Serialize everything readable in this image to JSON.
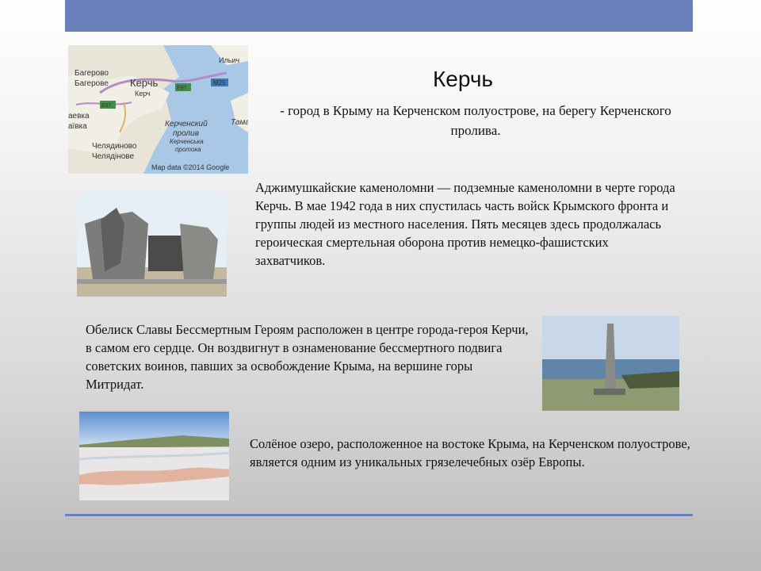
{
  "title": "Керчь",
  "subtitle": "- город в Крыму на Керченском полуострове, на берегу Керченского пролива.",
  "map": {
    "labels": {
      "bagerovo_ru": "Багерово",
      "bagerovo_ua": "Багерове",
      "kerch_ru": "Керчь",
      "kerch_ua": "Керч",
      "ilyich": "Ильич",
      "road_e97_a": "E97",
      "road_e97_b": "E97",
      "road_m25": "M25",
      "aevka": "аевка",
      "aivka": "аївка",
      "strait_ru": "Керченский",
      "strait_ru2": "пролив",
      "strait_ua": "Керченська",
      "strait_ua2": "протока",
      "taman": "Тама",
      "chelyadinovo_ru": "Челядиново",
      "chelyadinovo_ua": "Челядінове",
      "credit": "Map data ©2014 Google"
    }
  },
  "sections": [
    {
      "text": "Аджимушкайские каменоломни — подземные каменоломни в черте города Керчь. В мае 1942 года в них спустилась часть войск Крымского фронта и группы людей из местного населения. Пять месяцев здесь продолжалась героическая смертельная оборона против немецко-фашистских захватчиков."
    },
    {
      "text": "Обелиск Славы Бессмертным Героям расположен в центре города-героя Керчи, в самом его сердце. Он воздвигнут в ознаменование бессмертного подвига советских воинов, павших за освобождение Крыма, на вершине горы Митридат."
    },
    {
      "text": "Солёное озеро, расположенное на востоке Крыма, на Керченском полуострове, является одним из уникальных грязелечебных озёр Европы."
    }
  ],
  "colors": {
    "accent": "#6b7fbd"
  }
}
